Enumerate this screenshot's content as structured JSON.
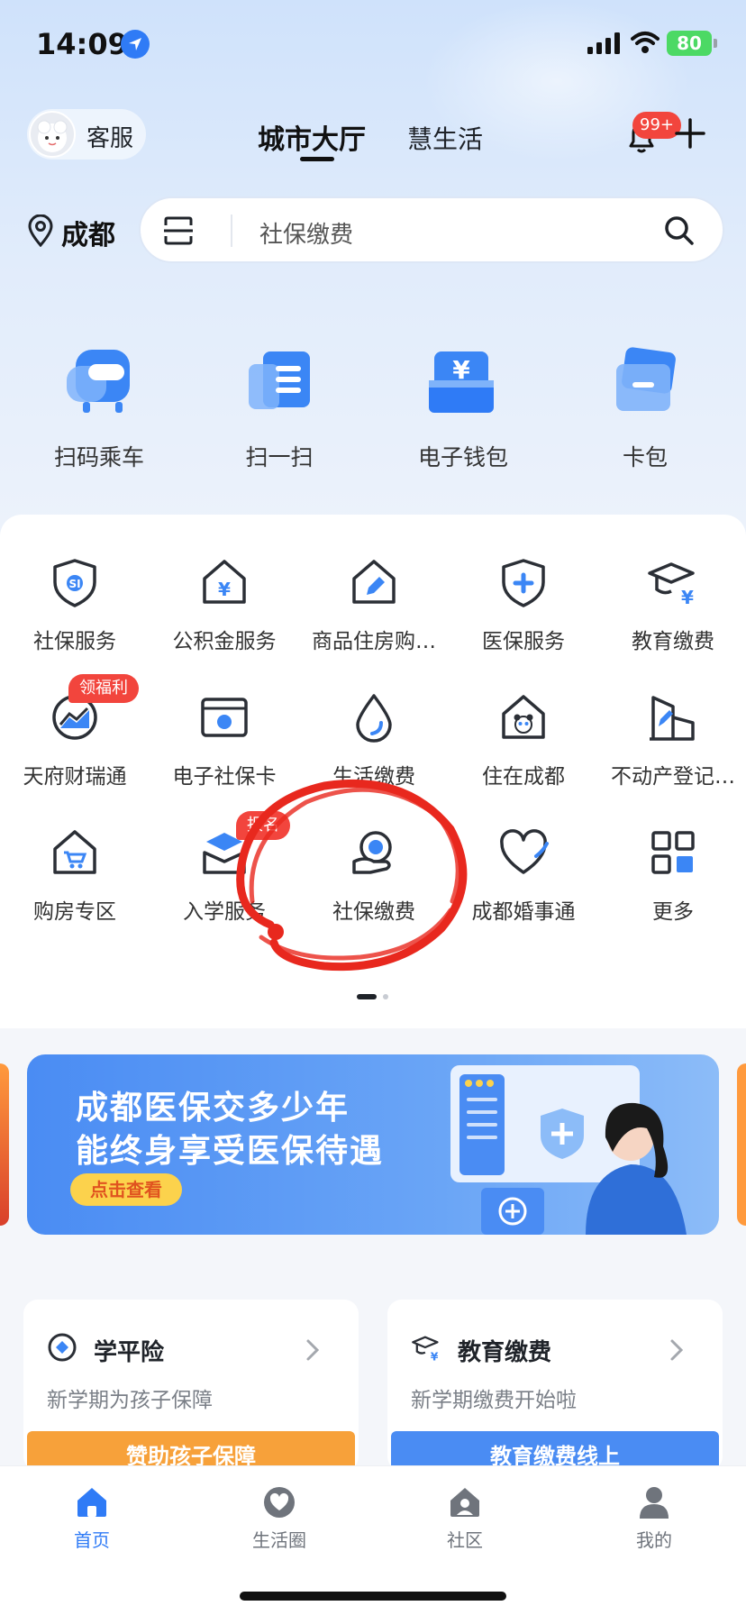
{
  "status_bar": {
    "time": "14:09",
    "battery": "80"
  },
  "header": {
    "kefu_label": "客服",
    "tab_main": "城市大厅",
    "tab_life": "慧生活",
    "notification_badge": "99+"
  },
  "location": {
    "city": "成都"
  },
  "search": {
    "placeholder": "社保缴费"
  },
  "quick_actions": [
    {
      "label": "扫码乘车",
      "icon": "bus-qr-icon"
    },
    {
      "label": "扫一扫",
      "icon": "scan-icon"
    },
    {
      "label": "电子钱包",
      "icon": "wallet-icon"
    },
    {
      "label": "卡包",
      "icon": "card-icon"
    }
  ],
  "services": [
    {
      "label": "社保服务",
      "icon": "social-security-shield-icon"
    },
    {
      "label": "公积金服务",
      "icon": "housing-fund-icon"
    },
    {
      "label": "商品住房购…",
      "icon": "house-pen-icon"
    },
    {
      "label": "医保服务",
      "icon": "medical-shield-icon"
    },
    {
      "label": "教育缴费",
      "icon": "education-cap-icon"
    },
    {
      "label": "天府财瑞通",
      "icon": "finance-chart-icon",
      "tag": "领福利"
    },
    {
      "label": "电子社保卡",
      "icon": "e-social-card-icon"
    },
    {
      "label": "生活缴费",
      "icon": "water-drop-icon"
    },
    {
      "label": "住在成都",
      "icon": "panda-house-icon"
    },
    {
      "label": "不动产登记…",
      "icon": "real-estate-icon"
    },
    {
      "label": "购房专区",
      "icon": "cart-house-icon"
    },
    {
      "label": "入学服务",
      "icon": "school-enroll-icon",
      "tag": "报名"
    },
    {
      "label": "社保缴费",
      "icon": "social-payment-icon"
    },
    {
      "label": "成都婚事通",
      "icon": "heart-icon"
    },
    {
      "label": "更多",
      "icon": "grid-more-icon"
    }
  ],
  "banner": {
    "line1": "成都医保交多少年",
    "line2": "能终身享受医保待遇",
    "button": "点击查看"
  },
  "cards": [
    {
      "title": "学平险",
      "subtitle": "新学期为孩子保障",
      "cta": "赞助孩子保障",
      "color": "#f7a13a"
    },
    {
      "title": "教育缴费",
      "subtitle": "新学期缴费开始啦",
      "cta": "教育缴费线上",
      "color": "#4a8cf3"
    }
  ],
  "tabbar": [
    {
      "label": "首页",
      "icon": "home-icon",
      "active": true
    },
    {
      "label": "生活圈",
      "icon": "heart-circle-icon",
      "active": false
    },
    {
      "label": "社区",
      "icon": "community-icon",
      "active": false
    },
    {
      "label": "我的",
      "icon": "profile-icon",
      "active": false
    }
  ],
  "colors": {
    "accent": "#2f7bf6",
    "badge": "#f2453d",
    "annotation": "#e8281e"
  }
}
